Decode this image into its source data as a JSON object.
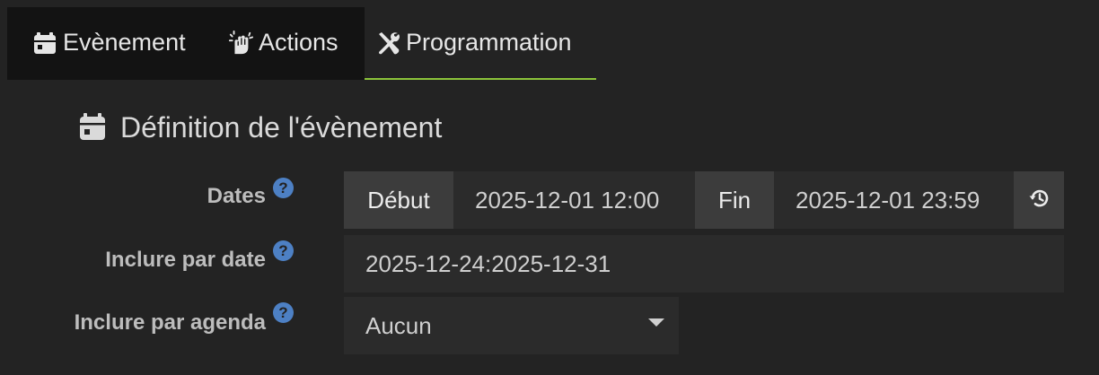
{
  "tabs": [
    {
      "label": "Evènement",
      "icon": "calendar-icon"
    },
    {
      "label": "Actions",
      "icon": "hand-sparkle-icon"
    },
    {
      "label": "Programmation",
      "icon": "tools-icon"
    }
  ],
  "active_tab": "Programmation",
  "section": {
    "title": "Définition de l'évènement",
    "icon": "calendar-icon"
  },
  "form": {
    "dates": {
      "label": "Dates",
      "help": "?",
      "start_addon": "Début",
      "start_value": "2025-12-01 12:00",
      "end_addon": "Fin",
      "end_value": "2025-12-01 23:59",
      "reset_icon": "history-icon"
    },
    "include_date": {
      "label": "Inclure par date",
      "help": "?",
      "value": "2025-12-24:2025-12-31"
    },
    "include_agenda": {
      "label": "Inclure par agenda",
      "help": "?",
      "value": "Aucun"
    }
  },
  "colors": {
    "accent": "#8cc43a",
    "help": "#4d80c4",
    "background": "#232323"
  }
}
